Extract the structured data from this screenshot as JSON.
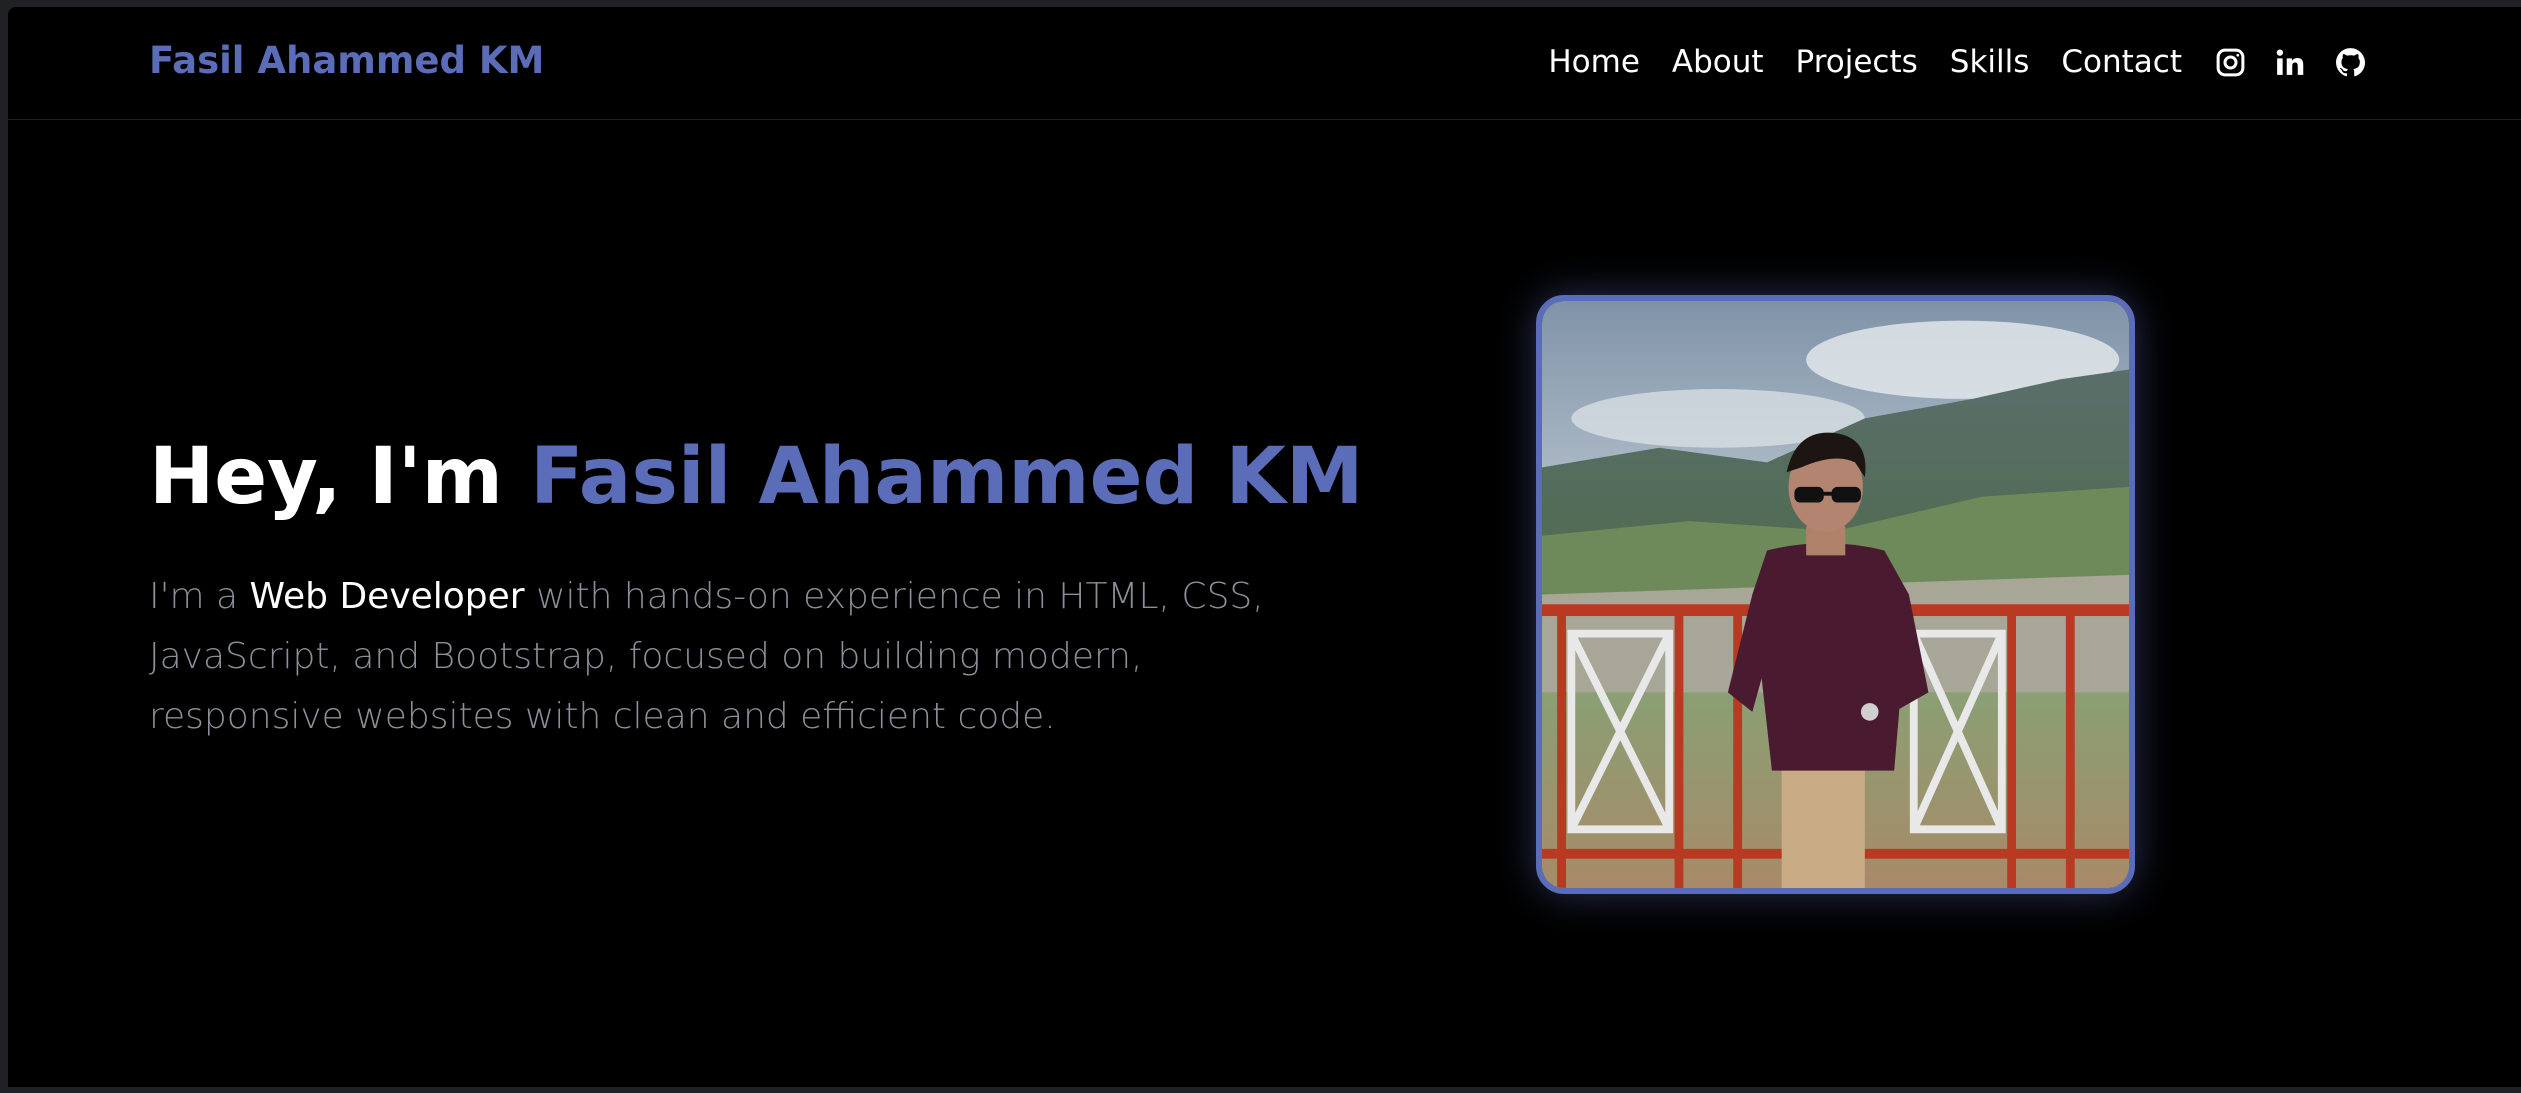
{
  "navbar": {
    "brand": "Fasil Ahammed KM",
    "links": [
      "Home",
      "About",
      "Projects",
      "Skills",
      "Contact"
    ],
    "icons": [
      "instagram-icon",
      "linkedin-icon",
      "github-icon"
    ]
  },
  "hero": {
    "greeting": "Hey, I'm ",
    "name": "Fasil Ahammed KM",
    "desc_prefix": "I'm a ",
    "desc_highlight": "Web Developer",
    "desc_rest": " with hands-on experience in HTML, CSS, JavaScript, and Bootstrap, focused on building modern, responsive websites with clean and efficient code."
  },
  "colors": {
    "accent": "#5b6cb8",
    "background": "#000000",
    "text": "#ffffff",
    "muted": "#8b8f99"
  }
}
